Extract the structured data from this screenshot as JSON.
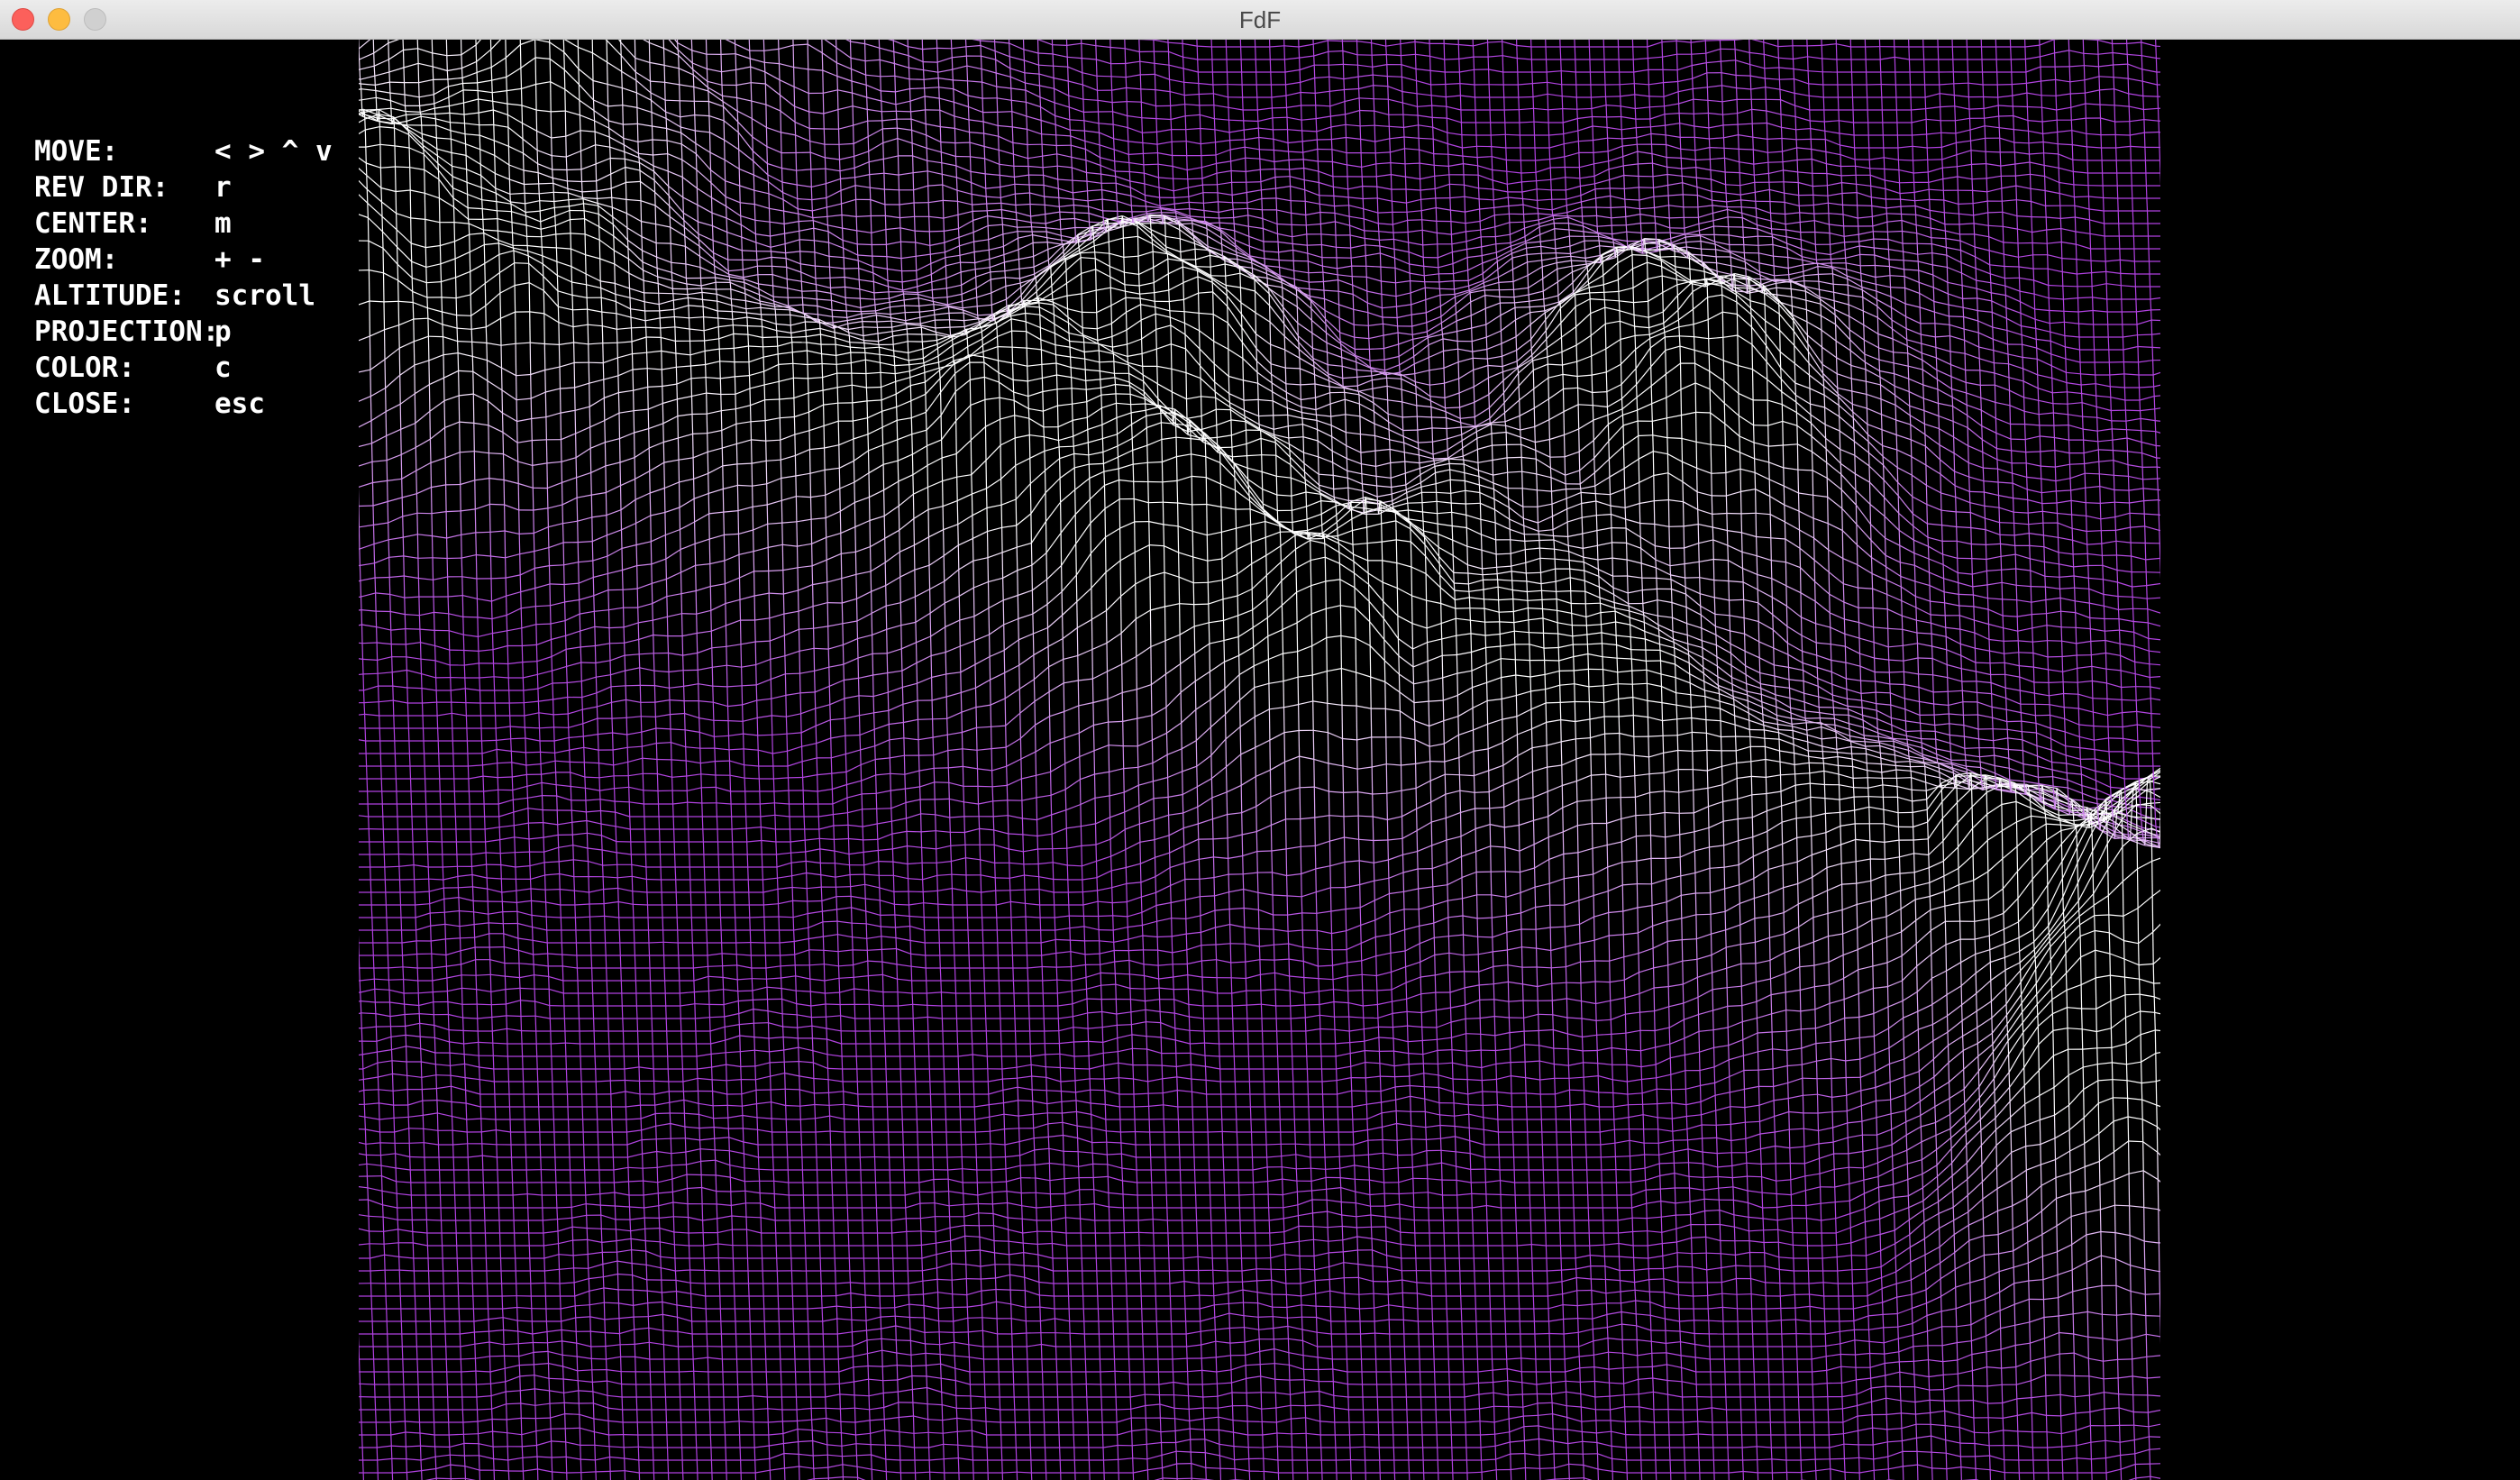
{
  "window": {
    "title": "FdF"
  },
  "controls": [
    {
      "label": "MOVE:",
      "value": "< > ^ v"
    },
    {
      "label": "REV DIR:",
      "value": "r"
    },
    {
      "label": "CENTER:",
      "value": "m"
    },
    {
      "label": "ZOOM:",
      "value": "+ -"
    },
    {
      "label": "ALTITUDE:",
      "value": "scroll"
    },
    {
      "label": "PROJECTION:",
      "value": "p"
    },
    {
      "label": "COLOR:",
      "value": "c"
    },
    {
      "label": "CLOSE:",
      "value": "esc"
    }
  ],
  "colors": {
    "background": "#000000",
    "low": "#b040e0",
    "high": "#ffffff"
  }
}
